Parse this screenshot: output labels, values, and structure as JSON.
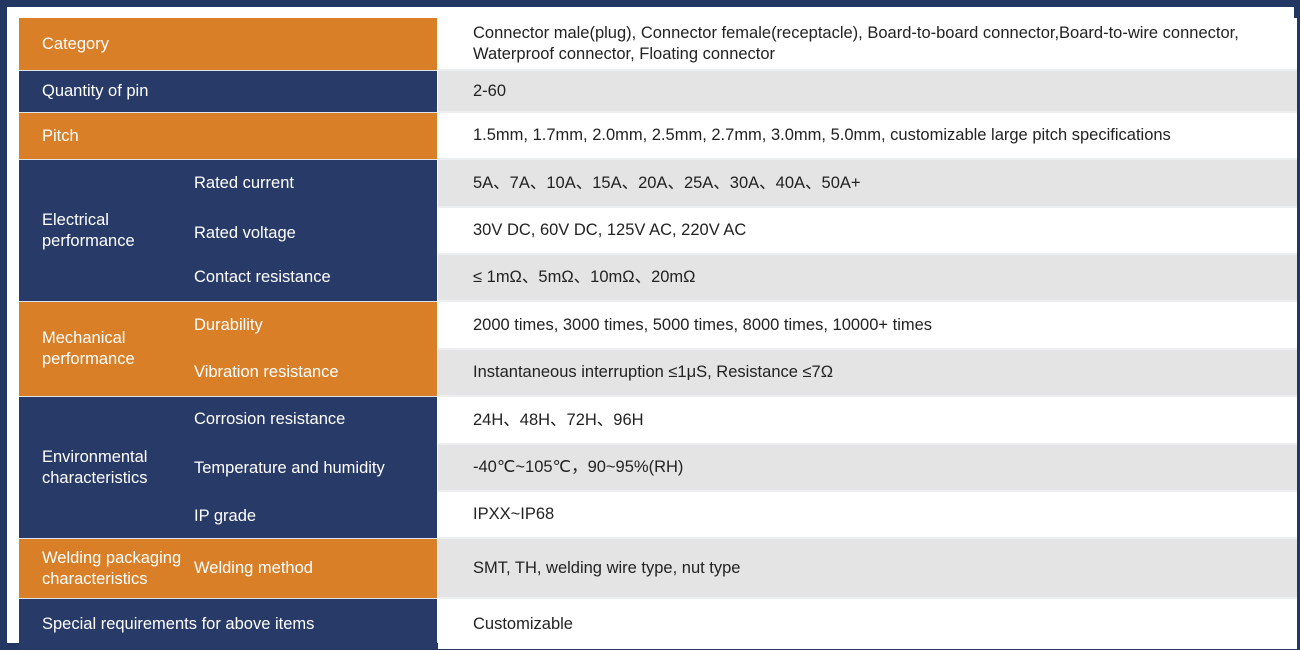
{
  "colors": {
    "background": "#233763",
    "navy": "#283a68",
    "orange": "#d97f27",
    "row_gray": "#e4e4e4"
  },
  "rows": [
    {
      "category": "Category",
      "value": "Connector male(plug), Connector female(receptacle), Board-to-board connector,Board-to-wire connector, Waterproof connector, Floating connector"
    },
    {
      "category": "Quantity of pin",
      "value": "2-60"
    },
    {
      "category": "Pitch",
      "value": "1.5mm, 1.7mm, 2.0mm, 2.5mm, 2.7mm, 3.0mm, 5.0mm, customizable large pitch specifications"
    },
    {
      "category": "Electrical performance",
      "items": [
        {
          "name": "Rated current",
          "value": "5A、7A、10A、15A、20A、25A、30A、40A、50A+"
        },
        {
          "name": "Rated voltage",
          "value": "30V DC, 60V DC, 125V AC, 220V AC"
        },
        {
          "name": "Contact resistance",
          "value": "≤ 1mΩ、5mΩ、10mΩ、20mΩ"
        }
      ]
    },
    {
      "category": "Mechanical performance",
      "items": [
        {
          "name": "Durability",
          "value": "2000 times, 3000 times, 5000 times, 8000 times, 10000+ times"
        },
        {
          "name": "Vibration resistance",
          "value": "Instantaneous interruption ≤1μS, Resistance ≤7Ω"
        }
      ]
    },
    {
      "category": "Environmental characteristics",
      "items": [
        {
          "name": "Corrosion resistance",
          "value": "24H、48H、72H、96H"
        },
        {
          "name": "Temperature and humidity",
          "value": "-40℃~105℃，90~95%(RH)"
        },
        {
          "name": "IP grade",
          "value": "IPXX~IP68"
        }
      ]
    },
    {
      "category": "Welding packaging characteristics",
      "items": [
        {
          "name": "Welding method",
          "value": "SMT, TH, welding wire type, nut type"
        }
      ]
    },
    {
      "category": "Special requirements for above items",
      "value": "Customizable"
    }
  ]
}
